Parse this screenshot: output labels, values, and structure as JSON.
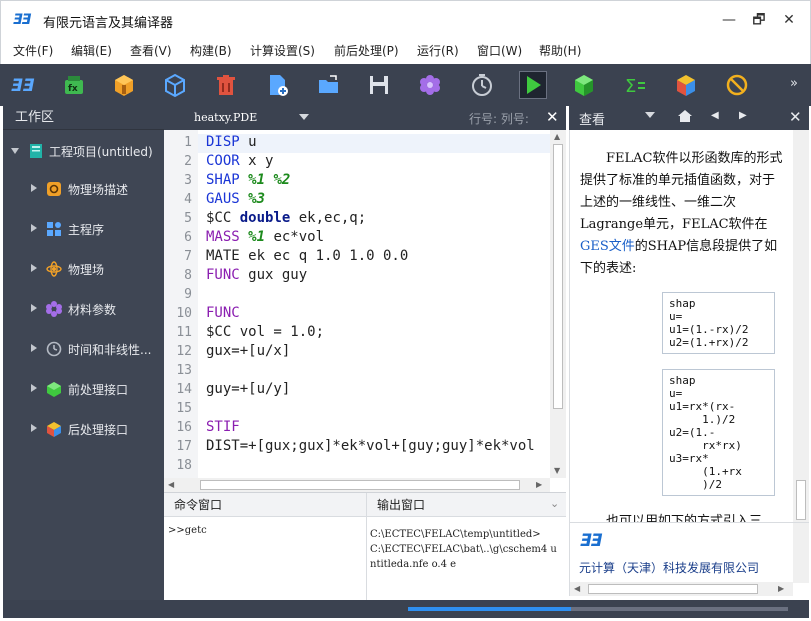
{
  "window": {
    "logo": "ƎƎ",
    "title": "有限元语言及其编译器",
    "minimize": "—",
    "restore": "🗗",
    "close": "✕"
  },
  "menu": [
    "文件(F)",
    "编辑(E)",
    "查看(V)",
    "构建(B)",
    "计算设置(S)",
    "前后处理(P)",
    "运行(R)",
    "窗口(W)",
    "帮助(H)"
  ],
  "toolbar": {
    "items": [
      "app-logo-icon",
      "fx-icon",
      "package-icon",
      "cube-icon",
      "trash-icon",
      "new-file-icon",
      "open-folder-icon",
      "save-icon",
      "flower-icon",
      "clock-icon",
      "play-icon",
      "green-cube-icon",
      "sigma-icon",
      "colored-cube-icon",
      "stop-icon"
    ],
    "overflow": "»"
  },
  "workspace": {
    "title": "工作区",
    "root": "工程项目(untitled)",
    "items": [
      {
        "label": "物理场描述",
        "icon": "orange-gear-icon"
      },
      {
        "label": "主程序",
        "icon": "blue-grid-icon"
      },
      {
        "label": "物理场",
        "icon": "orange-atom-icon"
      },
      {
        "label": "材料参数",
        "icon": "purple-flower-icon"
      },
      {
        "label": "时间和非线性...",
        "icon": "clock-icon"
      },
      {
        "label": "前处理接口",
        "icon": "green-cube-icon"
      },
      {
        "label": "后处理接口",
        "icon": "colored-cube-icon"
      }
    ]
  },
  "editor": {
    "filename": "heatxy.PDE",
    "rowcol": "行号: 列号:",
    "close": "✕",
    "lines": [
      {
        "n": "1",
        "parts": [
          {
            "t": "DISP",
            "c": "kw-blue"
          },
          {
            "t": " u",
            "c": ""
          }
        ]
      },
      {
        "n": "2",
        "parts": [
          {
            "t": "COOR",
            "c": "kw-blue"
          },
          {
            "t": " x y",
            "c": ""
          }
        ]
      },
      {
        "n": "3",
        "parts": [
          {
            "t": "SHAP",
            "c": "kw-blue"
          },
          {
            "t": " ",
            "c": ""
          },
          {
            "t": "%1 %2",
            "c": "kw-green"
          }
        ]
      },
      {
        "n": "4",
        "parts": [
          {
            "t": "GAUS",
            "c": "kw-blue"
          },
          {
            "t": " ",
            "c": ""
          },
          {
            "t": "%3",
            "c": "kw-green"
          }
        ]
      },
      {
        "n": "5",
        "parts": [
          {
            "t": "$CC ",
            "c": ""
          },
          {
            "t": "double",
            "c": "kw-bold"
          },
          {
            "t": " ek,ec,q;",
            "c": ""
          }
        ]
      },
      {
        "n": "6",
        "parts": [
          {
            "t": "MASS",
            "c": "kw-purple"
          },
          {
            "t": " ",
            "c": ""
          },
          {
            "t": "%1",
            "c": "kw-green"
          },
          {
            "t": " ec*vol",
            "c": ""
          }
        ]
      },
      {
        "n": "7",
        "parts": [
          {
            "t": "MATE ek ec q 1.0 1.0 0.0",
            "c": ""
          }
        ]
      },
      {
        "n": "8",
        "parts": [
          {
            "t": "FUNC",
            "c": "kw-purple"
          },
          {
            "t": " gux guy",
            "c": ""
          }
        ]
      },
      {
        "n": "9",
        "parts": []
      },
      {
        "n": "10",
        "parts": [
          {
            "t": "FUNC",
            "c": "kw-purple"
          }
        ]
      },
      {
        "n": "11",
        "parts": [
          {
            "t": "$CC vol = 1.0;",
            "c": ""
          }
        ]
      },
      {
        "n": "12",
        "parts": [
          {
            "t": "gux=+[u/x]",
            "c": ""
          }
        ]
      },
      {
        "n": "13",
        "parts": []
      },
      {
        "n": "14",
        "parts": [
          {
            "t": "guy=+[u/y]",
            "c": ""
          }
        ]
      },
      {
        "n": "15",
        "parts": []
      },
      {
        "n": "16",
        "parts": [
          {
            "t": "STIF",
            "c": "kw-purple"
          }
        ]
      },
      {
        "n": "17",
        "parts": [
          {
            "t": "DIST=+[gux;gux]*ek*vol+[guy;guy]*ek*vol",
            "c": ""
          }
        ]
      },
      {
        "n": "18",
        "parts": []
      }
    ]
  },
  "command_window": {
    "title": "命令窗口",
    "text": ">>getc"
  },
  "output_window": {
    "title": "输出窗口",
    "text": "C:\\ECTEC\\FELAC\\temp\\untitled>C:\\ECTEC\\FELAC\\bat\\..\\g\\cschem4 untitleda.nfe o.4 e"
  },
  "viewer": {
    "title": "查看",
    "close": "✕",
    "para_before": "FELAC软件以形函数库的形式提供了标准的单元插值函数，对于上述的一维线性、一维二次Lagrange单元，FELAC软件在",
    "para_link": "GES文件",
    "para_after": "的SHAP信息段提供了如下的表述:",
    "code1": "shap\nu=\nu1=(1.-rx)/2\nu2=(1.+rx)/2",
    "code2": "shap\nu=\nu1=rx*(rx-\n     1.)/2\nu2=(1.-\n     rx*rx)\nu3=rx*\n     (1.+rx\n     )/2",
    "tail": "也可以用如下的方式引入三"
  },
  "company": {
    "logo": "ƎƎ",
    "name": "元计算（天津）科技发展有限公司"
  },
  "status": {
    "progress": 0.43,
    "progress_color": "#2f8fef"
  }
}
